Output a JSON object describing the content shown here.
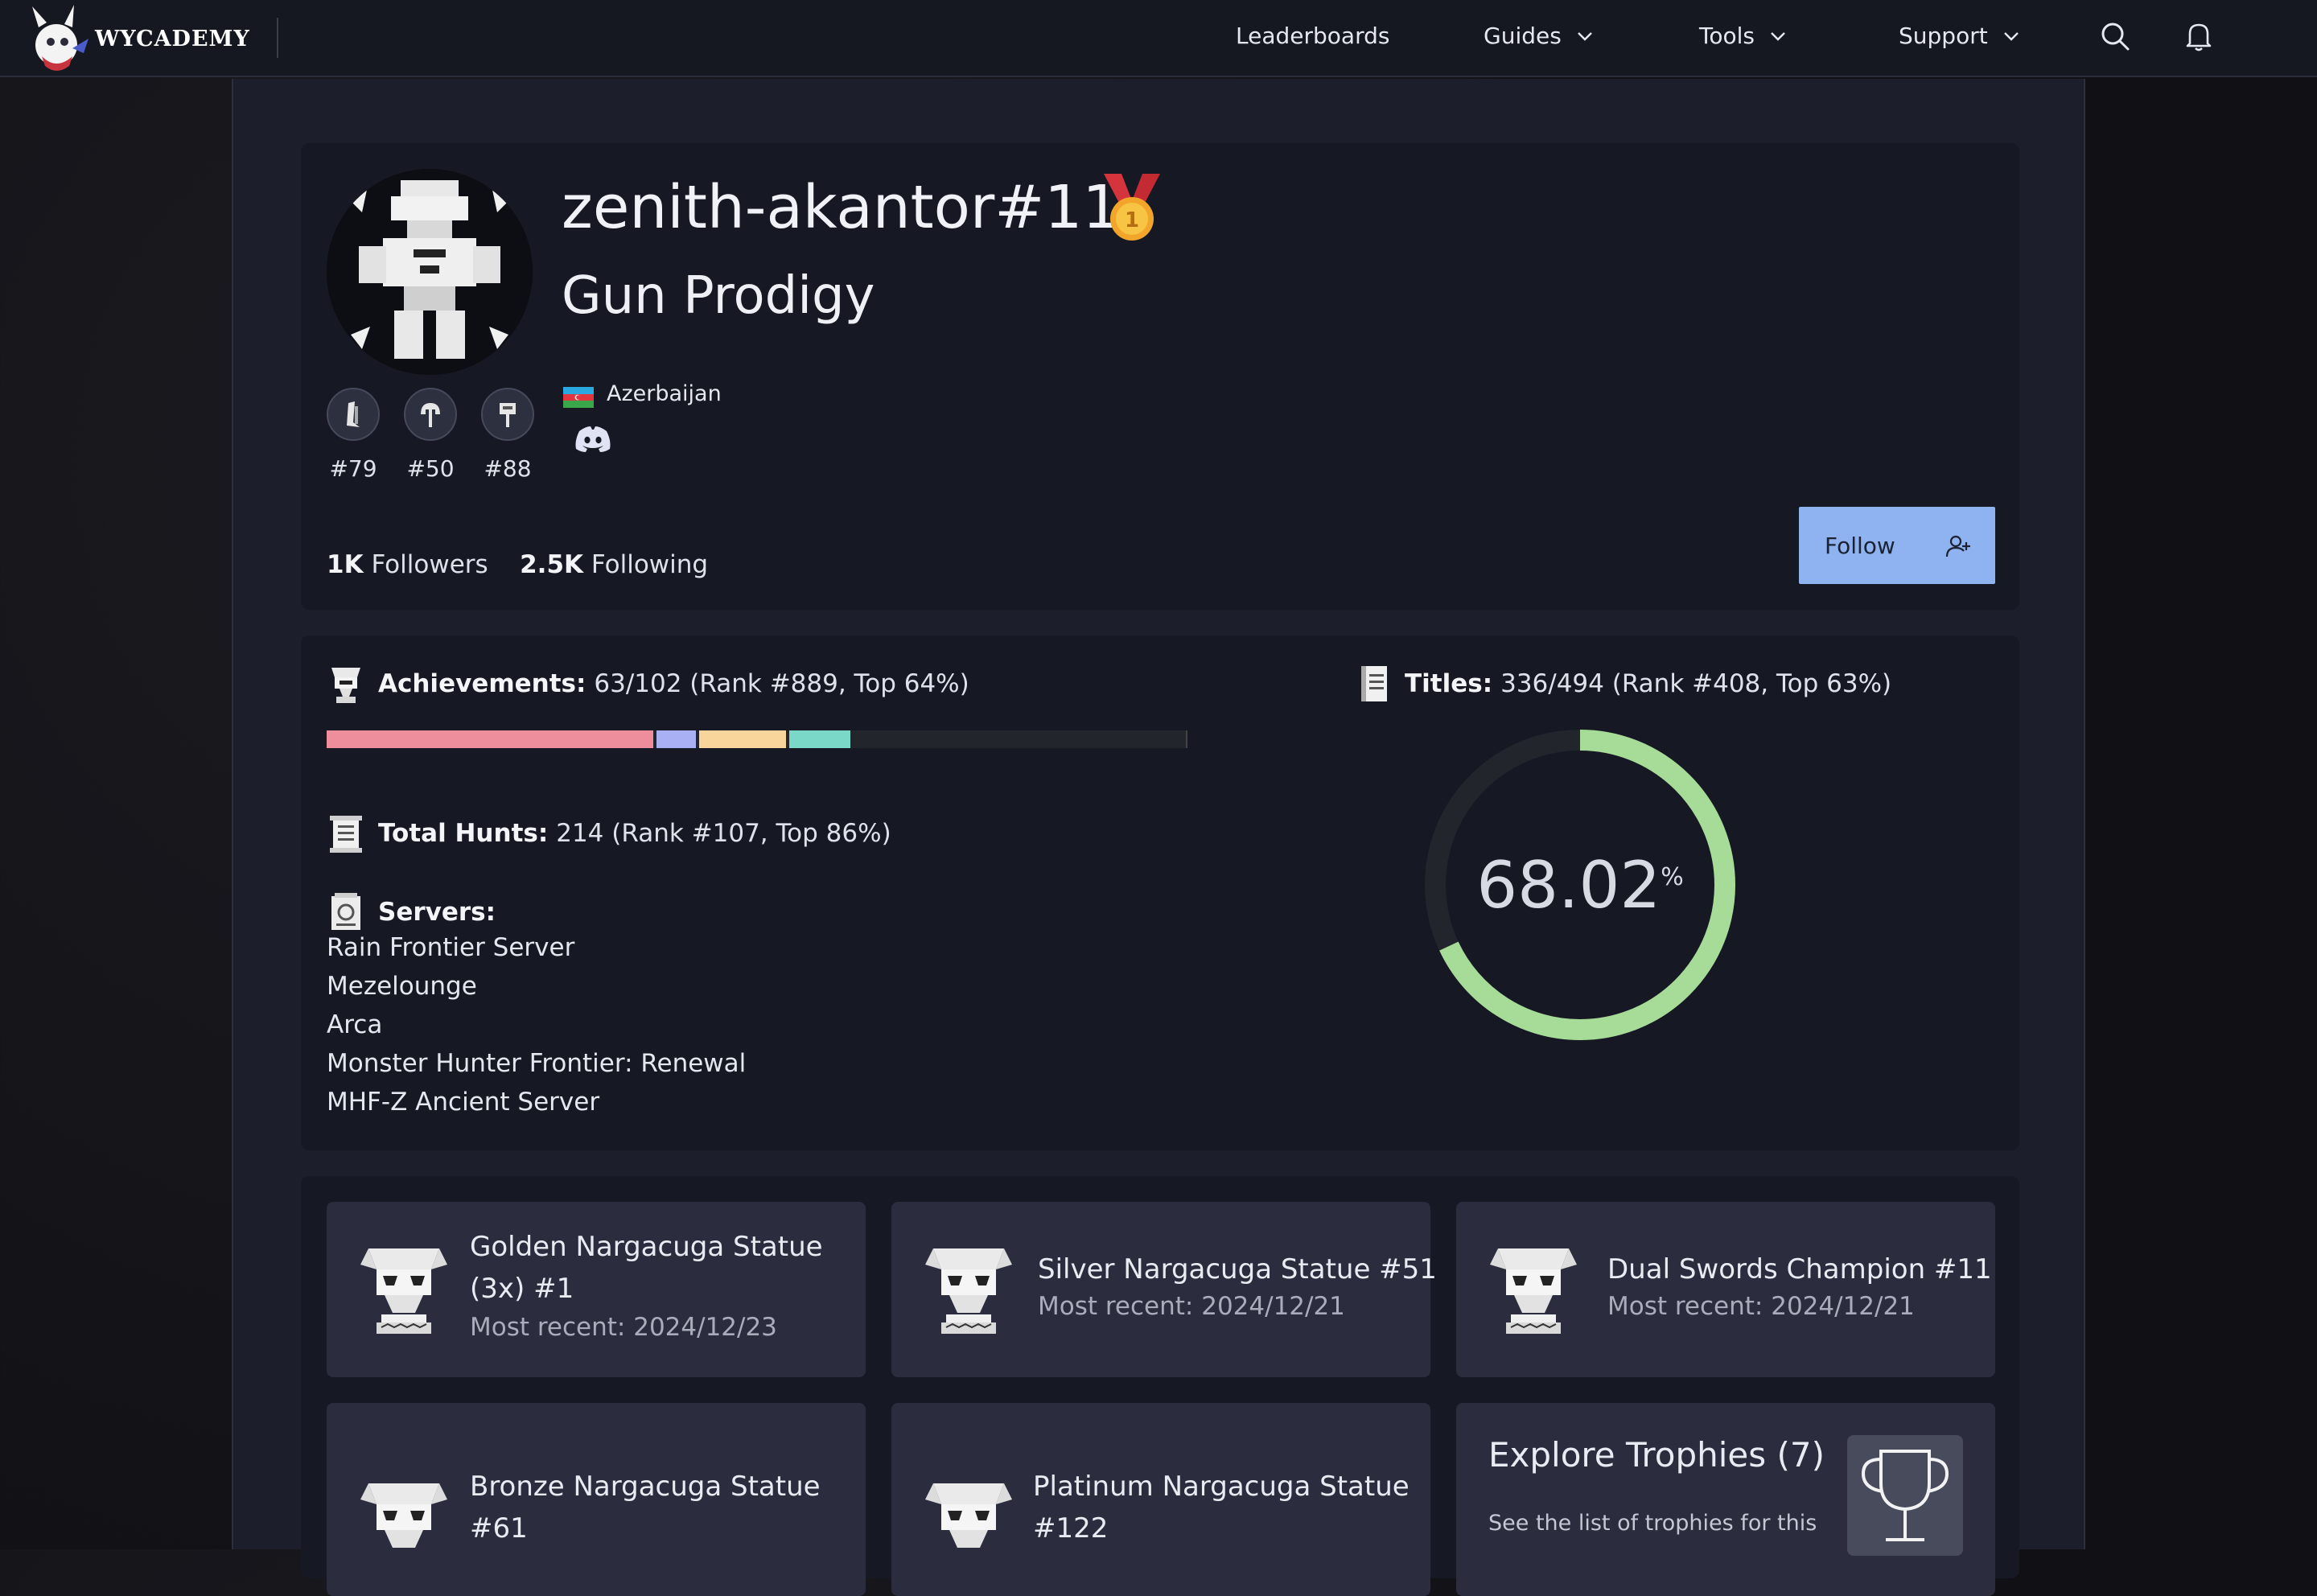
{
  "brand": {
    "name": "WYCADEMY"
  },
  "nav": {
    "items": [
      {
        "label": "Leaderboards"
      },
      {
        "label": "Guides"
      },
      {
        "label": "Tools"
      },
      {
        "label": "Support"
      }
    ]
  },
  "profile": {
    "username": "zenith-akantor#11",
    "title": "Gun Prodigy",
    "country": "Azerbaijan",
    "weapon_ranks": [
      "#79",
      "#50",
      "#88"
    ],
    "followers_count": "1K",
    "followers_label": "Followers",
    "following_count": "2.5K",
    "following_label": "Following",
    "follow_button": "Follow"
  },
  "stats": {
    "achievements_label": "Achievements:",
    "achievements_value": "63/102 (Rank #889, Top 64%)",
    "achievement_bar": {
      "segments": [
        {
          "fraction": 0.38,
          "color": "#ee8e9c"
        },
        {
          "fraction": 0.05,
          "color": "#a9b0f3"
        },
        {
          "fraction": 0.105,
          "color": "#f8d59b"
        },
        {
          "fraction": 0.075,
          "color": "#7ad8c8"
        }
      ],
      "track_color": "#23252d"
    },
    "titles_label": "Titles:",
    "titles_value": "336/494 (Rank #408, Top 63%)",
    "hunts_label": "Total Hunts:",
    "hunts_value": "214 (Rank #107, Top 86%)",
    "servers_label": "Servers:",
    "servers": [
      "Rain Frontier Server",
      "Mezelounge",
      "Arca",
      "Monster Hunter Frontier: Renewal",
      "MHF-Z Ancient Server"
    ],
    "completion_percent": 68.02,
    "completion_text": "68.02",
    "completion_unit": "%",
    "ring_color": "#a7dc98"
  },
  "trophies": {
    "items": [
      {
        "name_line1": "Golden Nargacuga Statue",
        "name_line2": "(3x) #1",
        "date": "Most recent: 2024/12/23"
      },
      {
        "name": "Silver Nargacuga Statue #51",
        "date": "Most recent: 2024/12/21"
      },
      {
        "name": "Dual Swords Champion #11",
        "date": "Most recent: 2024/12/21"
      },
      {
        "name_line1": "Bronze Nargacuga Statue",
        "name_line2": "#61"
      },
      {
        "name_line1": "Platinum Nargacuga Statue",
        "name_line2": "#122"
      }
    ],
    "explore_title": "Explore Trophies (7)",
    "explore_sub": "See the list of trophies for this"
  }
}
